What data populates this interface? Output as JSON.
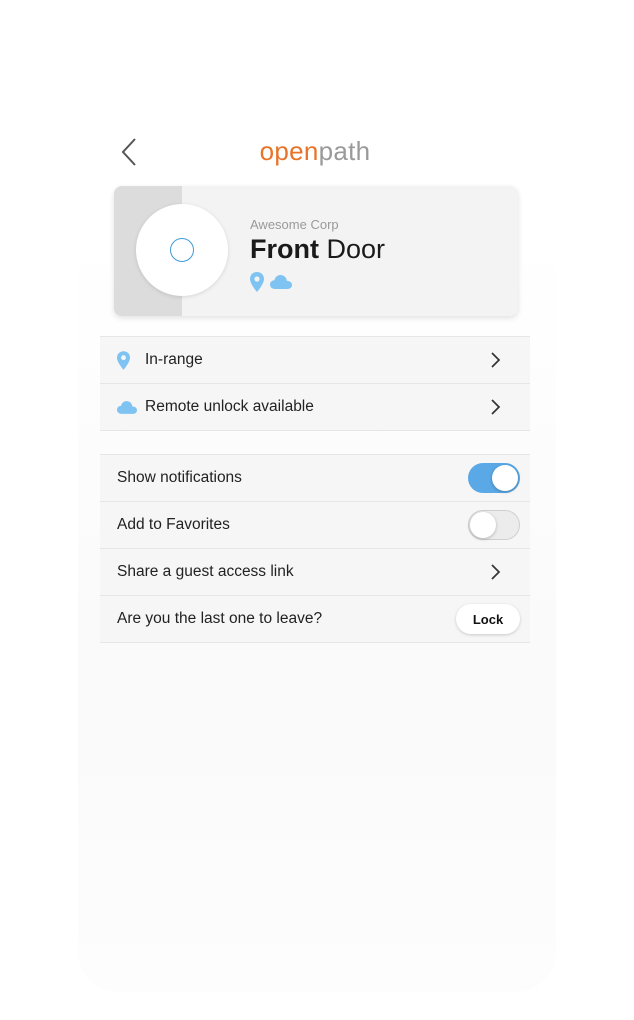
{
  "header": {
    "logo_open": "open",
    "logo_path": "path",
    "back_icon": "chevron-left-icon"
  },
  "door": {
    "organization": "Awesome Corp",
    "name_bold": "Front",
    "name_rest": " Door",
    "icons": [
      "location-pin-icon",
      "cloud-icon"
    ]
  },
  "status_list": [
    {
      "icon": "location-pin-icon",
      "label": "In-range"
    },
    {
      "icon": "cloud-icon",
      "label": "Remote unlock available"
    }
  ],
  "settings": {
    "show_notifications": {
      "label": "Show notifications",
      "enabled": true
    },
    "add_to_favorites": {
      "label": "Add to Favorites",
      "enabled": false
    },
    "share_guest_link": {
      "label": "Share a guest access link"
    },
    "last_one": {
      "label": "Are you the last one to leave?",
      "button": "Lock"
    }
  },
  "colors": {
    "brand_orange": "#e8742a",
    "brand_gray": "#9a9a9a",
    "accent_blue": "#5aa8e6",
    "icon_blue": "#7fc3f2"
  }
}
